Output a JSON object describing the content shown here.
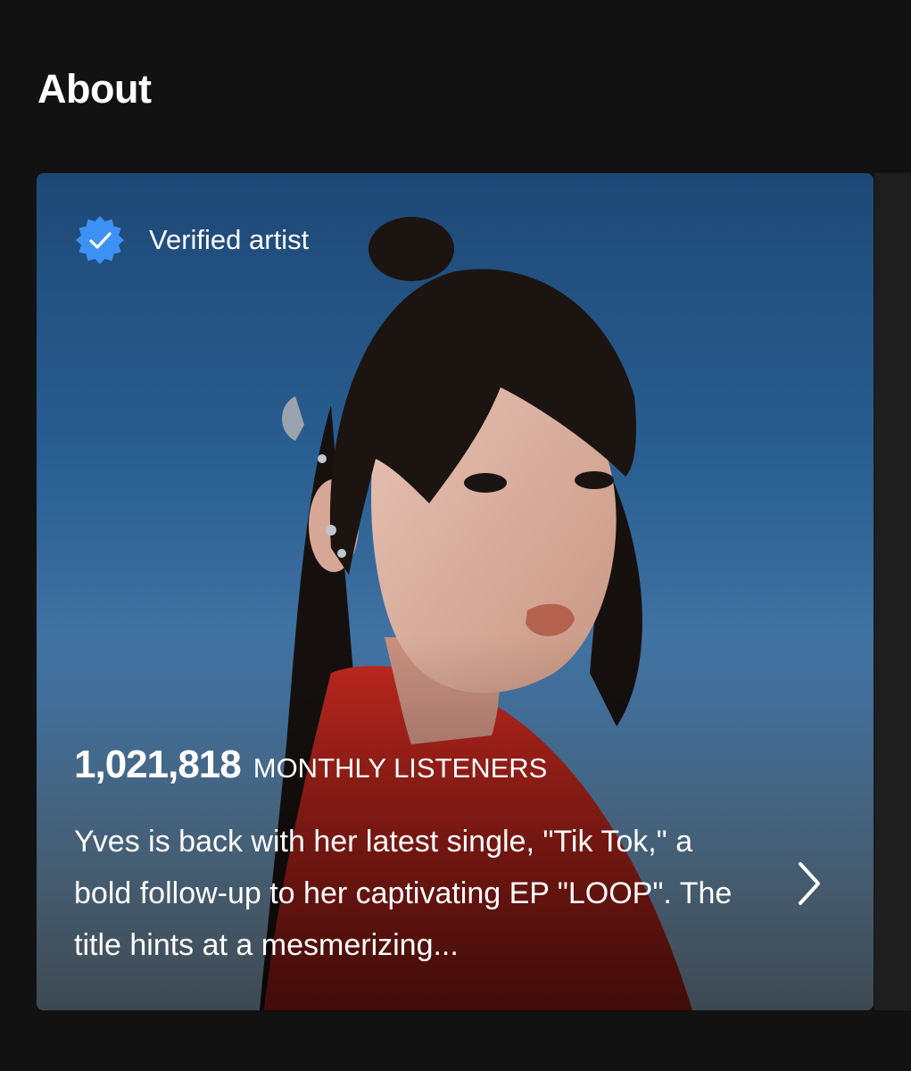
{
  "section": {
    "title": "About"
  },
  "card": {
    "verified_label": "Verified artist",
    "verified_icon": "verified-badge-icon",
    "verified_color": "#3d91f4",
    "listeners_count": "1,021,818",
    "listeners_label": "MONTHLY LISTENERS",
    "bio": "Yves is back with her latest single, \"Tik Tok,\" a bold follow-up to her captivating EP \"LOOP\". The title hints at a mesmerizing...",
    "more_icon": "chevron-right-icon"
  },
  "colors": {
    "background": "#121212",
    "card_sky": "#2a5f92",
    "shirt": "#b8261c",
    "text": "#ffffff"
  }
}
